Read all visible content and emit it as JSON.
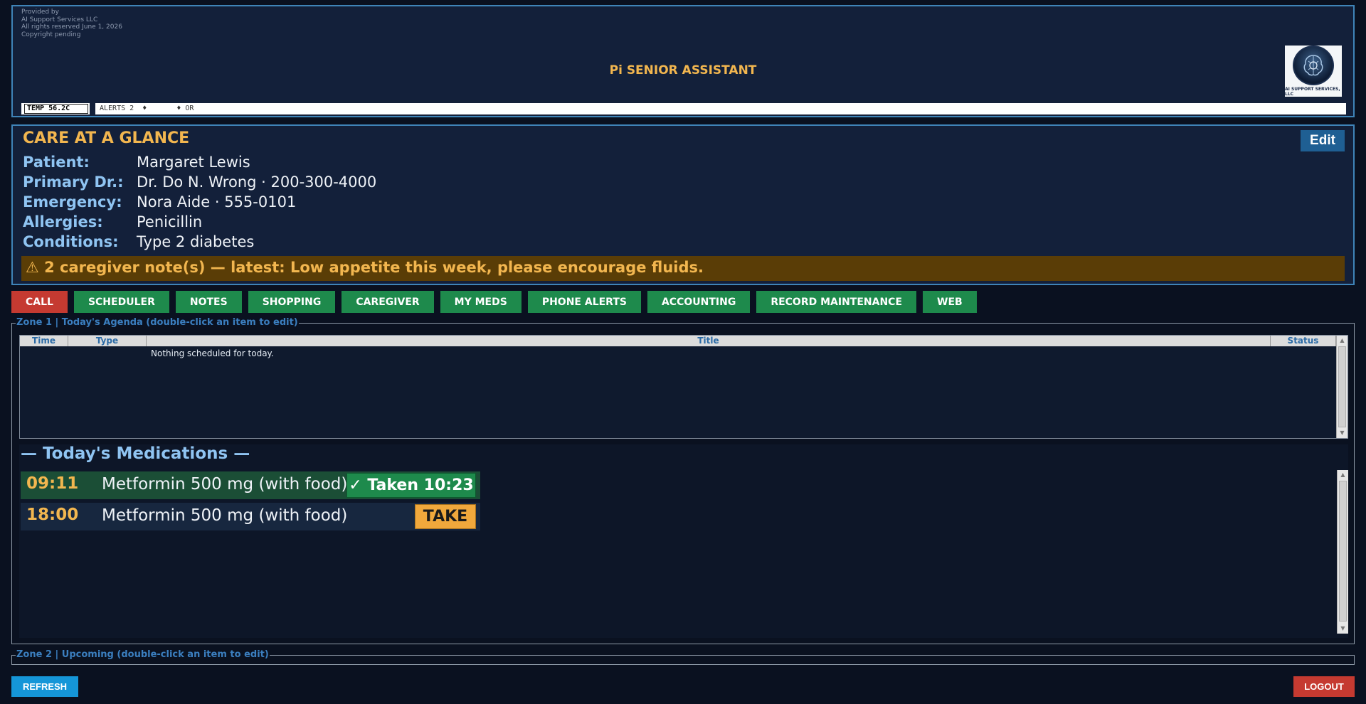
{
  "header": {
    "provided_lines": [
      "Provided by",
      "AI Support Services LLC",
      "All rights reserved  June 1, 2026",
      "Copyright pending"
    ],
    "app_title": "Pi SENIOR ASSISTANT",
    "logo_text": "AI SUPPORT SERVICES, LLC",
    "ticker": {
      "temp": "TEMP 56.2C",
      "alerts": "ALERTS 2  ♦       ♦ OR"
    }
  },
  "care": {
    "title": "CARE AT A GLANCE",
    "edit_label": "Edit",
    "rows": [
      {
        "label": "Patient:",
        "value": "Margaret Lewis"
      },
      {
        "label": "Primary Dr.:",
        "value": "Dr. Do N. Wrong · 200-300-4000"
      },
      {
        "label": "Emergency:",
        "value": "Nora Aide · 555-0101"
      },
      {
        "label": "Allergies:",
        "value": "Penicillin"
      },
      {
        "label": "Conditions:",
        "value": "Type 2 diabetes"
      }
    ],
    "note": "⚠ 2 caregiver note(s) — latest: Low appetite this week, please encourage fluids."
  },
  "nav": {
    "call": "CALL",
    "scheduler": "SCHEDULER",
    "notes": "NOTES",
    "shopping": "SHOPPING",
    "caregiver": "CAREGIVER",
    "my_meds": "MY MEDS",
    "phone_alerts": "PHONE ALERTS",
    "accounting": "ACCOUNTING",
    "record_maintenance": "RECORD MAINTENANCE",
    "web": "WEB"
  },
  "zone1": {
    "label": "Zone 1 | Today's Agenda  (double-click an item to edit)",
    "columns": [
      "Time",
      "Type",
      "Title",
      "Status"
    ],
    "empty_message": "Nothing scheduled for today.",
    "meds_title": "— Today's Medications —",
    "meds": [
      {
        "time": "09:11",
        "name": "Metformin 500 mg  (with food)",
        "action": "✓ Taken 10:23"
      },
      {
        "time": "18:00",
        "name": "Metformin 500 mg  (with food)",
        "action": "TAKE"
      }
    ]
  },
  "zone2": {
    "label": "Zone 2 | Upcoming  (double-click an item to edit)"
  },
  "footer": {
    "refresh": "REFRESH",
    "logout": "LOGOUT"
  }
}
